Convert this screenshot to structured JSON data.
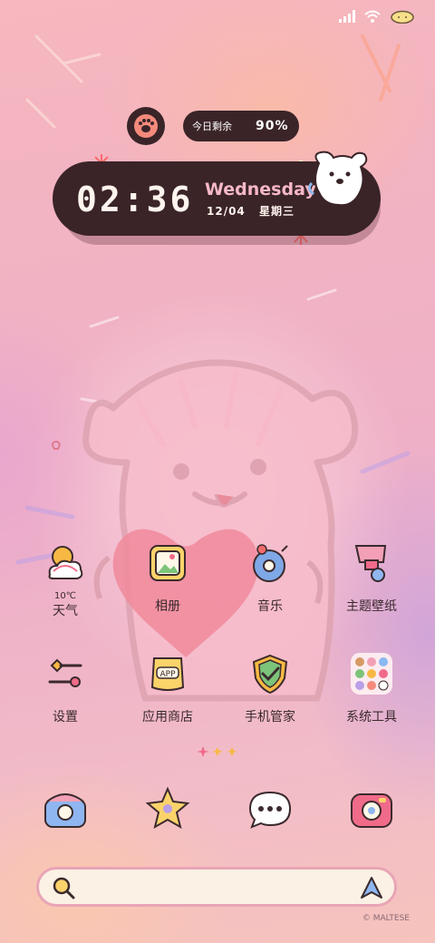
{
  "status_bar": {
    "icons": [
      "signal-icon",
      "wifi-icon",
      "battery-icon"
    ]
  },
  "battery_widget": {
    "label": "今日剩余",
    "value": "90%"
  },
  "clock_widget": {
    "time": "02:36",
    "weekday": "Wednesday",
    "date": "12/04",
    "day_of_week": "星期三"
  },
  "apps": [
    {
      "label": "天气",
      "temp": "10℃",
      "icon": "weather-icon"
    },
    {
      "label": "相册",
      "icon": "gallery-icon"
    },
    {
      "label": "音乐",
      "icon": "music-icon"
    },
    {
      "label": "主题壁纸",
      "icon": "theme-icon"
    },
    {
      "label": "设置",
      "icon": "settings-icon"
    },
    {
      "label": "应用商店",
      "icon": "app-store-icon"
    },
    {
      "label": "手机管家",
      "icon": "phone-manager-icon"
    },
    {
      "label": "系统工具",
      "icon": "system-tools-icon"
    }
  ],
  "dock": [
    {
      "icon": "phone-icon"
    },
    {
      "icon": "browser-icon"
    },
    {
      "icon": "messages-icon"
    },
    {
      "icon": "camera-icon"
    }
  ],
  "search_bar": {
    "icon": "search-icon",
    "assistant_icon": "assistant-icon"
  },
  "watermark": "© MALTESE",
  "colors": {
    "widget_bg": "#3a2428",
    "accent_pink": "#f7b8c8",
    "search_bg": "#fbf1e4"
  }
}
